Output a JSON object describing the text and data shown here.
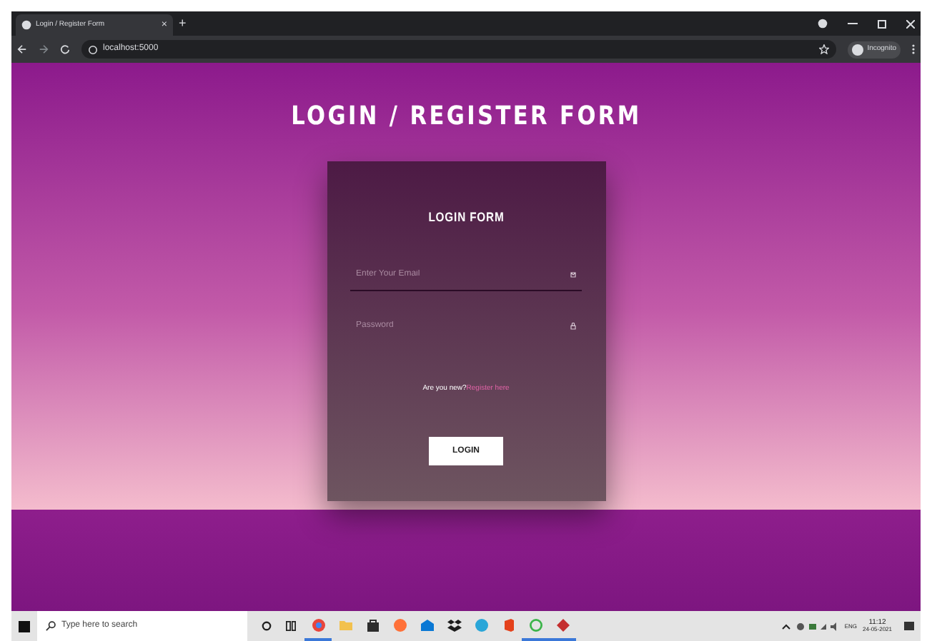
{
  "browser": {
    "tab": {
      "title": "Login / Register Form",
      "close": "×"
    },
    "new_tab": "+",
    "address": "localhost:5000",
    "profile": "Incognito"
  },
  "page": {
    "heading": "LOGIN / REGISTER FORM",
    "form": {
      "title": "LOGIN FORM",
      "fields": [
        {
          "placeholder": "Enter Your Email",
          "kind": "email"
        },
        {
          "placeholder": "Password",
          "kind": "password"
        }
      ],
      "prompt": "Are you new?",
      "link": "Register here",
      "button": "LOGIN"
    }
  },
  "taskbar": {
    "search": {
      "placeholder": "Type here to search"
    },
    "apps": [
      {
        "kind": "browser",
        "color": "#e8453c",
        "running": true
      },
      {
        "kind": "folder",
        "color": "#f2c14e",
        "running": false
      },
      {
        "kind": "bag",
        "color": "#2d2d2d",
        "running": false
      },
      {
        "kind": "fox",
        "color": "#ff7139",
        "running": false
      },
      {
        "kind": "mail",
        "color": "#0a78d4",
        "running": false
      },
      {
        "kind": "box",
        "color": "#1d1d1d",
        "running": false
      },
      {
        "kind": "wave",
        "color": "#2aa6d8",
        "running": false
      },
      {
        "kind": "office",
        "color": "#e4411b",
        "running": false
      },
      {
        "kind": "ring",
        "color": "#3cb44a",
        "running": true
      },
      {
        "kind": "gem",
        "color": "#c42f2f",
        "running": true
      }
    ],
    "language": "ENG",
    "time": "11:12",
    "date": "24-05-2021"
  }
}
